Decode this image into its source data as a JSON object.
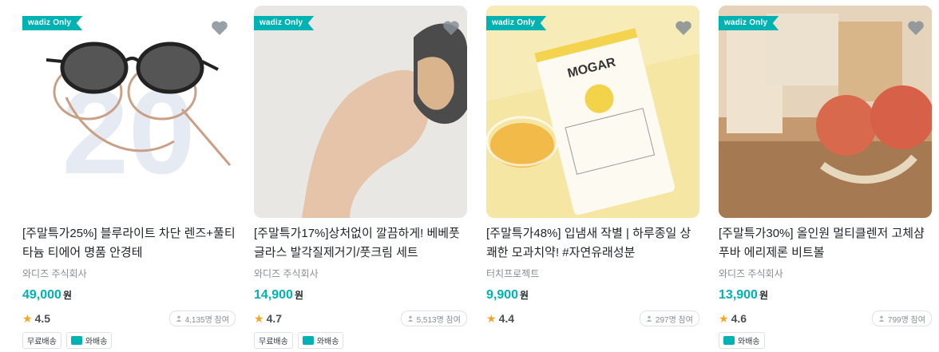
{
  "products": [
    {
      "badge": "wadiz Only",
      "title": "[주말특가25%] 블루라이트 차단 렌즈+풀티타늄 티에어 명품 안경테",
      "maker": "와디즈 주식회사",
      "price": "49,000",
      "currency": "원",
      "rating": "4.5",
      "participants": "4,135명 참여",
      "tags": [
        "무료배송",
        "와배송"
      ],
      "image": "sunglasses",
      "bg": "#ffffff"
    },
    {
      "badge": "wadiz Only",
      "title": "[주말특가17%]상처없이 깔끔하게! 베베풋 글라스 발각질제거기/풋크림 세트",
      "maker": "와디즈 주식회사",
      "price": "14,900",
      "currency": "원",
      "rating": "4.7",
      "participants": "5,513명 참여",
      "tags": [
        "무료배송",
        "와배송"
      ],
      "image": "foot-file",
      "bg": "#e8e6e3"
    },
    {
      "badge": "wadiz Only",
      "title": "[주말특가48%] 입냄새 작별 | 하루종일 상쾌한 모과치약! #자연유래성분",
      "maker": "터치프로젝트",
      "price": "9,900",
      "currency": "원",
      "rating": "4.4",
      "participants": "297명 참여",
      "tags": [],
      "image": "toothpaste",
      "bg": "#f6e9a6"
    },
    {
      "badge": "wadiz Only",
      "title": "[주말특가30%] 올인원 멀티클렌저 고체샴푸바 에리제론 비트볼",
      "maker": "와디즈 주식회사",
      "price": "13,900",
      "currency": "원",
      "rating": "4.6",
      "participants": "799명 참여",
      "tags": [
        "와배송"
      ],
      "image": "shampoo-bar",
      "bg": "#b88a60"
    }
  ],
  "colors": {
    "accent": "#00b2b2",
    "star": "#f5a623"
  }
}
